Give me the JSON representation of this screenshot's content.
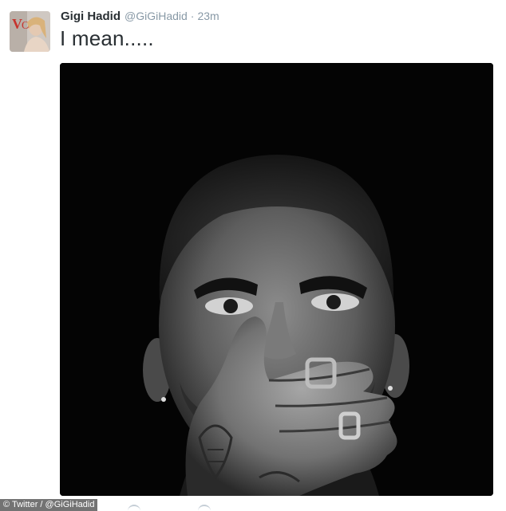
{
  "tweet": {
    "display_name": "Gigi Hadid",
    "handle": "@GiGiHadid",
    "separator": "·",
    "time": "23m",
    "text": "I mean.....",
    "avatar_icon": "profile-photo",
    "media_icon": "portrait-photo-black-and-white"
  },
  "footer": {
    "watermark": "© Twitter / @GiGiHadid"
  },
  "colors": {
    "name": "#292f33",
    "secondary": "#8899a6",
    "media_background": "#040404"
  }
}
